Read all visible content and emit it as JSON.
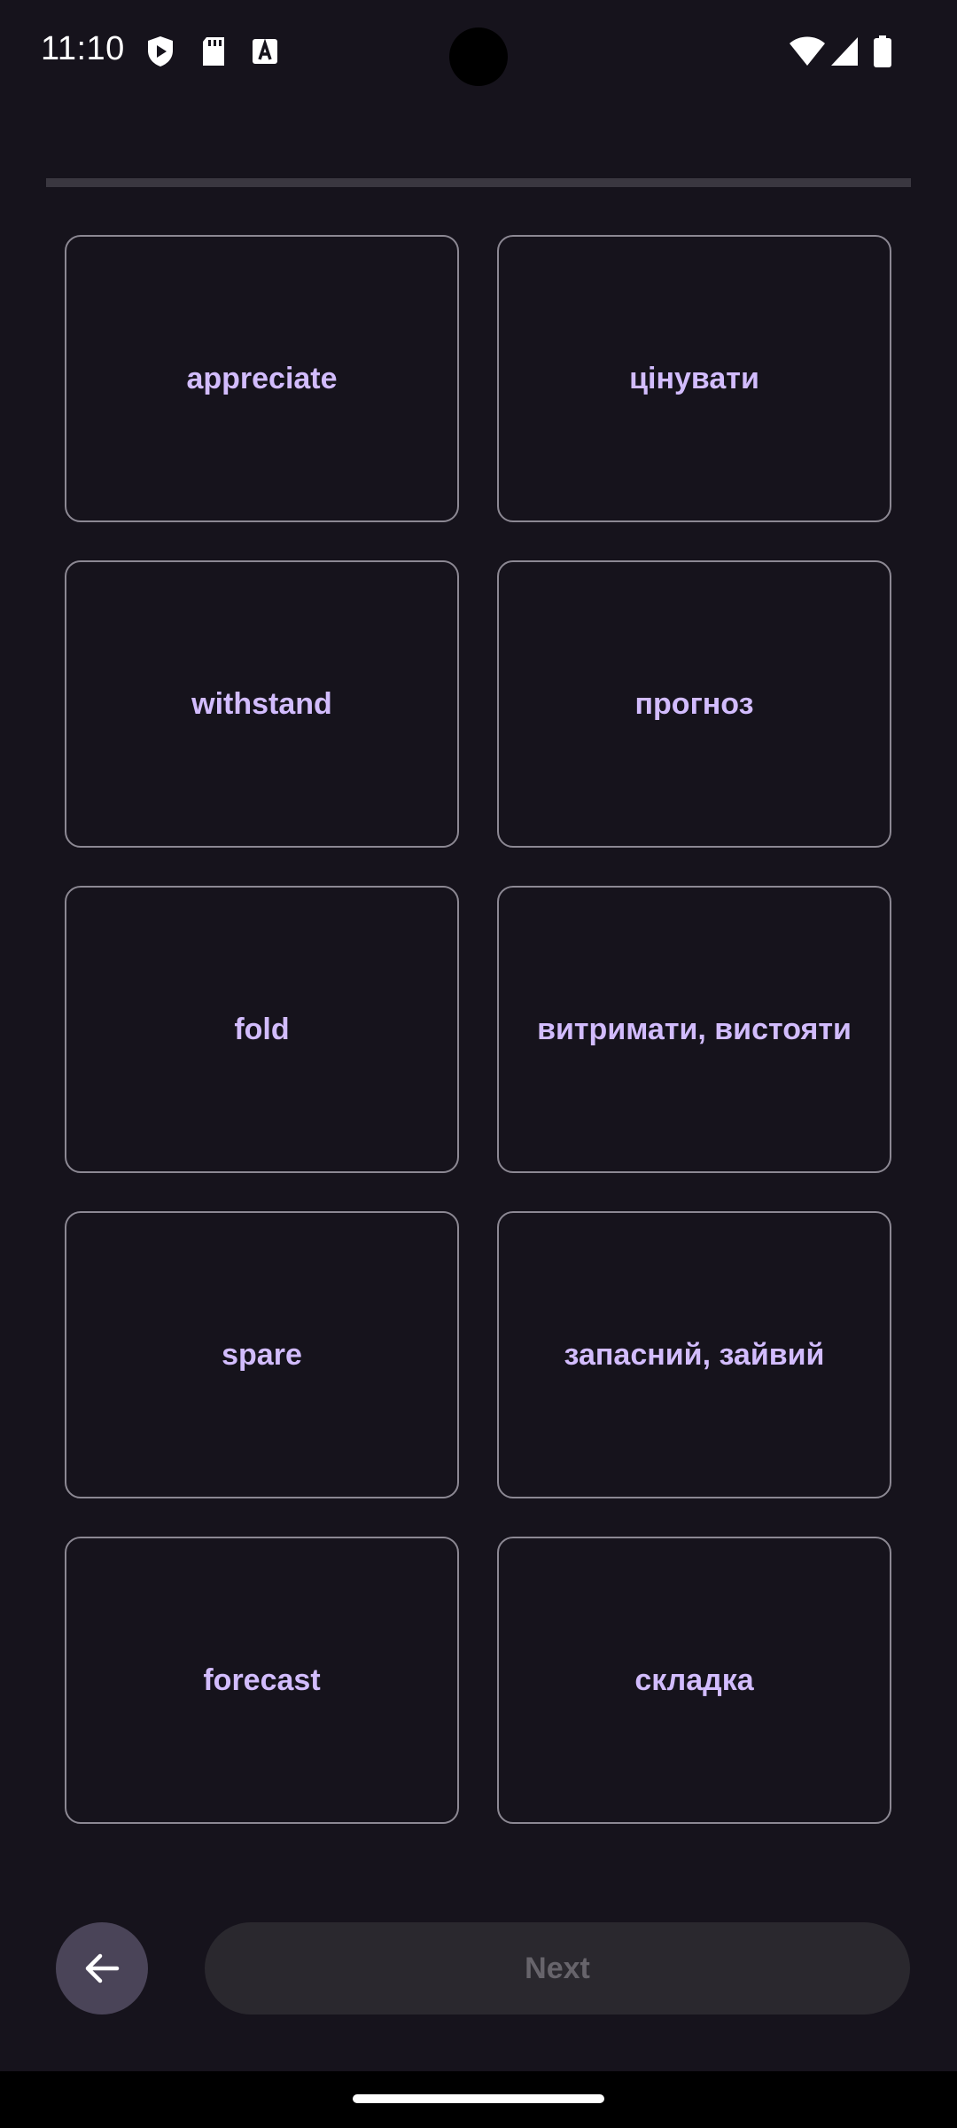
{
  "status_bar": {
    "time": "11:10",
    "left_icons": [
      "shield-play-icon",
      "sd-card-icon",
      "font-a-icon"
    ],
    "right_icons": [
      "wifi-icon",
      "cell-signal-icon",
      "battery-icon"
    ]
  },
  "progress": {
    "value": 0
  },
  "cards": [
    {
      "label": "appreciate",
      "column": "left"
    },
    {
      "label": "цінувати",
      "column": "right"
    },
    {
      "label": "withstand",
      "column": "left"
    },
    {
      "label": "прогноз",
      "column": "right"
    },
    {
      "label": "fold",
      "column": "left"
    },
    {
      "label": "витримати, вистояти",
      "column": "right"
    },
    {
      "label": "spare",
      "column": "left"
    },
    {
      "label": "запасний, зайвий",
      "column": "right"
    },
    {
      "label": "forecast",
      "column": "left"
    },
    {
      "label": "складка",
      "column": "right"
    }
  ],
  "footer": {
    "back_icon": "arrow-left-icon",
    "next_label": "Next",
    "next_enabled": false
  },
  "colors": {
    "background": "#16131c",
    "card_text": "#d2bcfd",
    "card_border": "#8c8893",
    "back_button": "#4a4458",
    "next_disabled_bg": "#2a282e",
    "next_disabled_text": "#67646b"
  }
}
